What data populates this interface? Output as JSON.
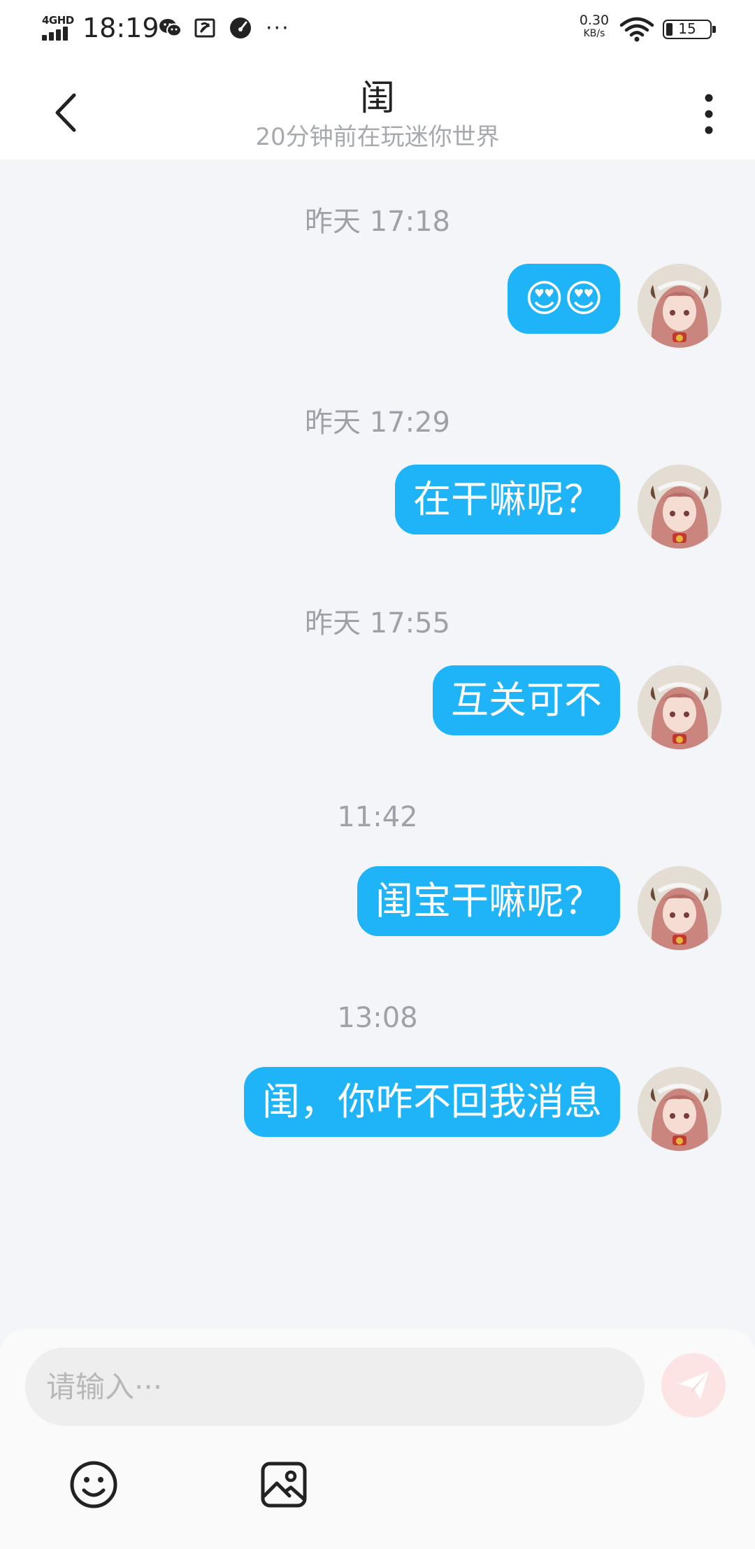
{
  "status_bar": {
    "network": "4GHD",
    "time": "18:19",
    "dots": "···",
    "speed_value": "0.30",
    "speed_unit": "KB/s",
    "battery": "15"
  },
  "header": {
    "title": "闺",
    "subtitle": "20分钟前在玩迷你世界"
  },
  "messages": [
    {
      "time": "昨天 17:18",
      "text": "😍😍",
      "type": "emoji"
    },
    {
      "time": "昨天 17:29",
      "text": "在干嘛呢？",
      "type": "text"
    },
    {
      "time": "昨天 17:55",
      "text": "互关可不",
      "type": "text"
    },
    {
      "time": "11:42",
      "text": "闺宝干嘛呢？",
      "type": "text"
    },
    {
      "time": "13:08",
      "text": "闺，你咋不回我消息",
      "type": "text"
    }
  ],
  "input": {
    "placeholder": "请输入···"
  },
  "colors": {
    "bubble": "#1fb3f7",
    "background": "#f3f5f8",
    "send_button": "#fde4e4"
  },
  "icons": {
    "back": "chevron-left-icon",
    "more": "more-vertical-icon",
    "send": "paper-plane-icon",
    "emoji": "smiley-icon",
    "image": "image-icon"
  }
}
